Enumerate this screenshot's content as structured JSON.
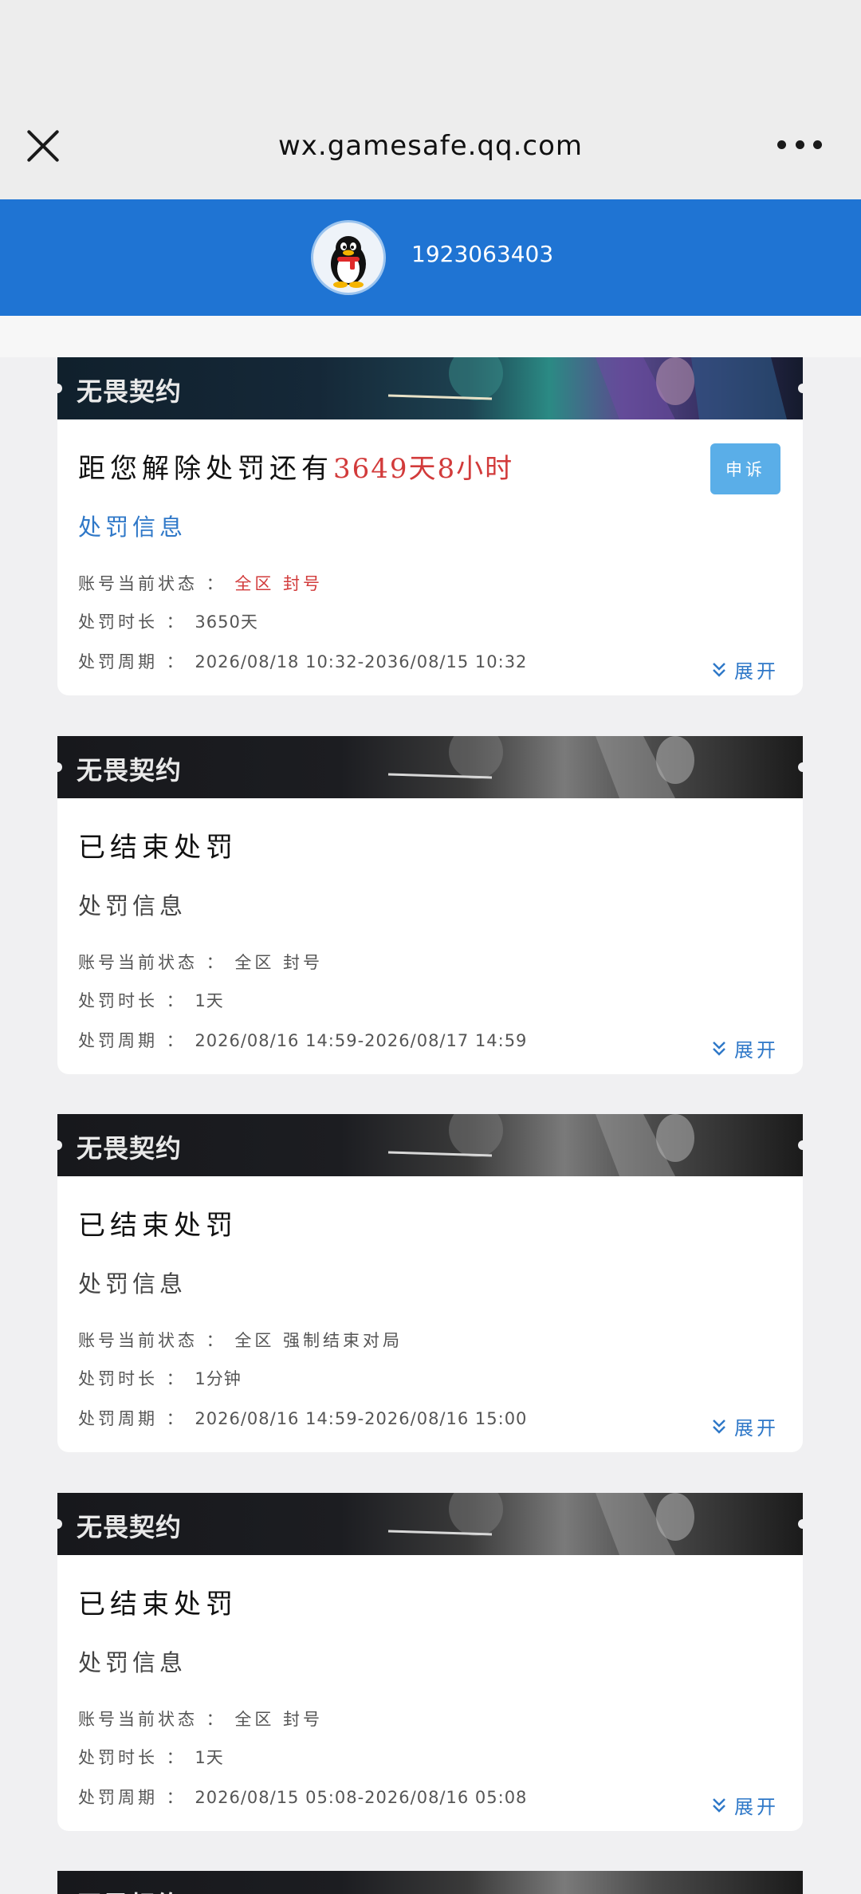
{
  "browser": {
    "url": "wx.gamesafe.qq.com"
  },
  "profile": {
    "qq_number": "1923063403"
  },
  "cards": [
    {
      "banner_title": "无畏契约",
      "status_prefix": "距您解除处罚还有",
      "status_remaining": "3649天8小时",
      "appeal_label": "申诉",
      "section_title": "处罚信息",
      "status_label": "账号当前状态 ：",
      "status_value": "全区 封号",
      "duration_label": "处罚时长 ：",
      "duration_value": "3650天",
      "period_label": "处罚周期 ：",
      "period_value": "2026/08/18 10:32-2036/08/15 10:32",
      "expand_label": "展开"
    },
    {
      "banner_title": "无畏契约",
      "status_text": "已结束处罚",
      "section_title": "处罚信息",
      "status_label": "账号当前状态 ：",
      "status_value": "全区 封号",
      "duration_label": "处罚时长 ：",
      "duration_value": "1天",
      "period_label": "处罚周期 ：",
      "period_value": "2026/08/16 14:59-2026/08/17 14:59",
      "expand_label": "展开"
    },
    {
      "banner_title": "无畏契约",
      "status_text": "已结束处罚",
      "section_title": "处罚信息",
      "status_label": "账号当前状态 ：",
      "status_value": "全区 强制结束对局",
      "duration_label": "处罚时长 ：",
      "duration_value": "1分钟",
      "period_label": "处罚周期 ：",
      "period_value": "2026/08/16 14:59-2026/08/16 15:00",
      "expand_label": "展开"
    },
    {
      "banner_title": "无畏契约",
      "status_text": "已结束处罚",
      "section_title": "处罚信息",
      "status_label": "账号当前状态 ：",
      "status_value": "全区 封号",
      "duration_label": "处罚时长 ：",
      "duration_value": "1天",
      "period_label": "处罚周期 ：",
      "period_value": "2026/08/15 05:08-2026/08/16 05:08",
      "expand_label": "展开"
    },
    {
      "banner_title": "无畏契约"
    }
  ]
}
